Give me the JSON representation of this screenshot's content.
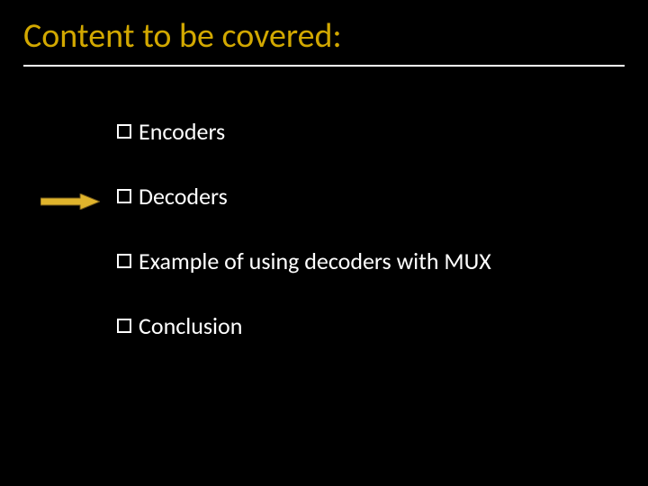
{
  "title": "Content to be covered:",
  "items": [
    {
      "label": "Encoders"
    },
    {
      "label": "Decoders"
    },
    {
      "label": "Example of using decoders with MUX"
    },
    {
      "label": "Conclusion"
    }
  ],
  "arrow": {
    "points_to_index": 1,
    "fill": "#e0b42c",
    "stroke": "#6a5218"
  }
}
